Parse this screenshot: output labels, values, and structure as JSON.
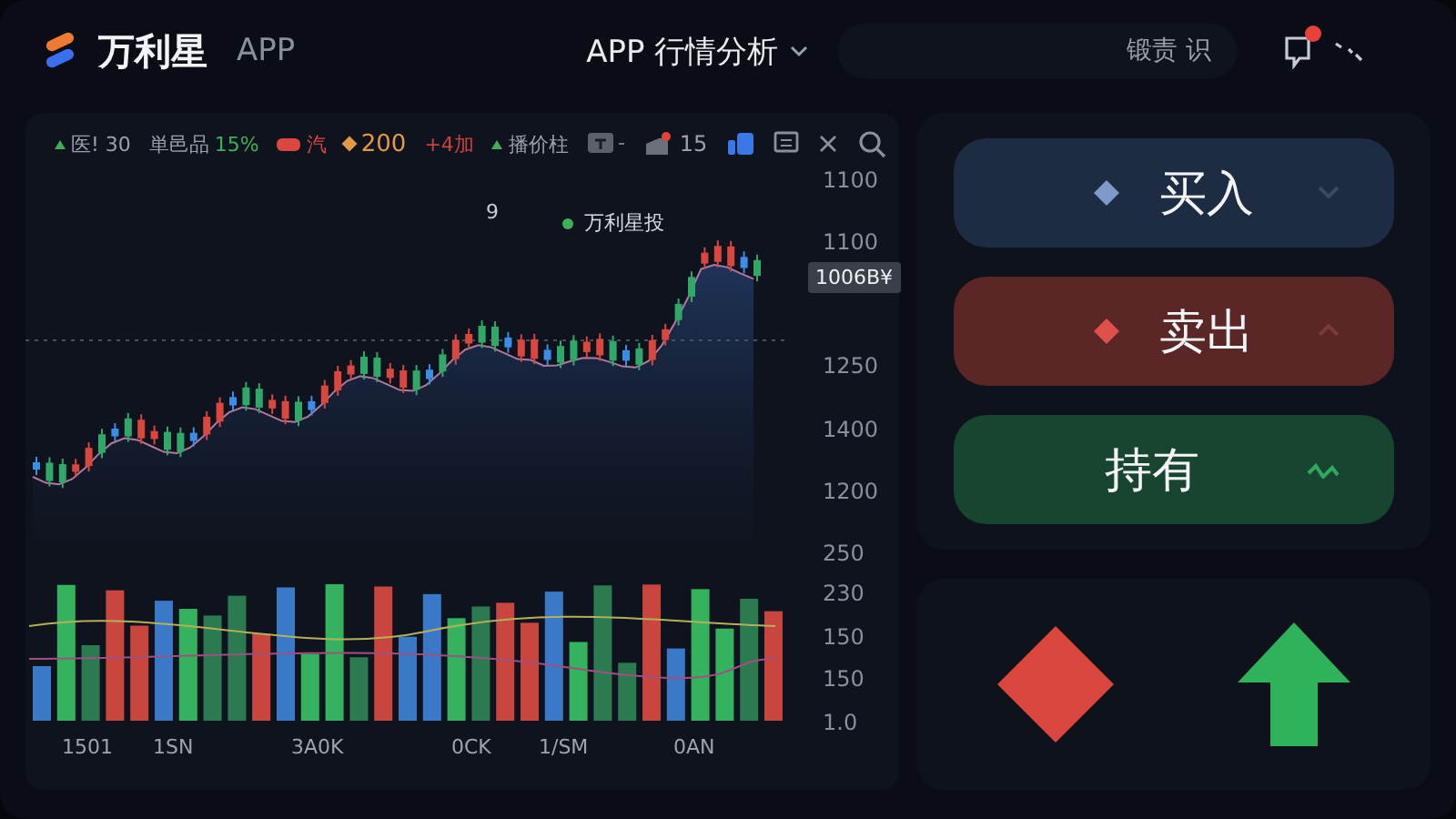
{
  "header": {
    "brand": "万利星",
    "brand_sub": "APP",
    "title": "APP 行情分析",
    "field_text": "锻责 识",
    "has_alert": true
  },
  "toolbar": [
    {
      "kind": "indicator",
      "text": "医! 30"
    },
    {
      "kind": "pair",
      "text": "単邑品",
      "value": "15%",
      "color": "#3fae5a"
    },
    {
      "kind": "pill",
      "text": "汽",
      "color": "#d9473f"
    },
    {
      "kind": "diamond",
      "text": "200",
      "color": "#e39a45"
    },
    {
      "kind": "plain",
      "text": "+4加",
      "color": "#c9433c"
    },
    {
      "kind": "indicator",
      "text": "播价柱"
    }
  ],
  "toolbar_count": "15",
  "chart": {
    "peak_label": "9",
    "legend": "万利星投",
    "price_tag": "1006B¥",
    "axis_labels": [
      "1100",
      "1100",
      "1250",
      "1400",
      "1200",
      "250",
      "230",
      "150",
      "150",
      "1.0"
    ],
    "x_labels": [
      "1501",
      "1SN",
      "3A0K",
      "0CK",
      "1/SM",
      "0AN"
    ]
  },
  "actions": [
    {
      "kind": "buy",
      "label": "买入"
    },
    {
      "kind": "sell",
      "label": "卖出"
    },
    {
      "kind": "hold",
      "label": "持有"
    }
  ]
}
